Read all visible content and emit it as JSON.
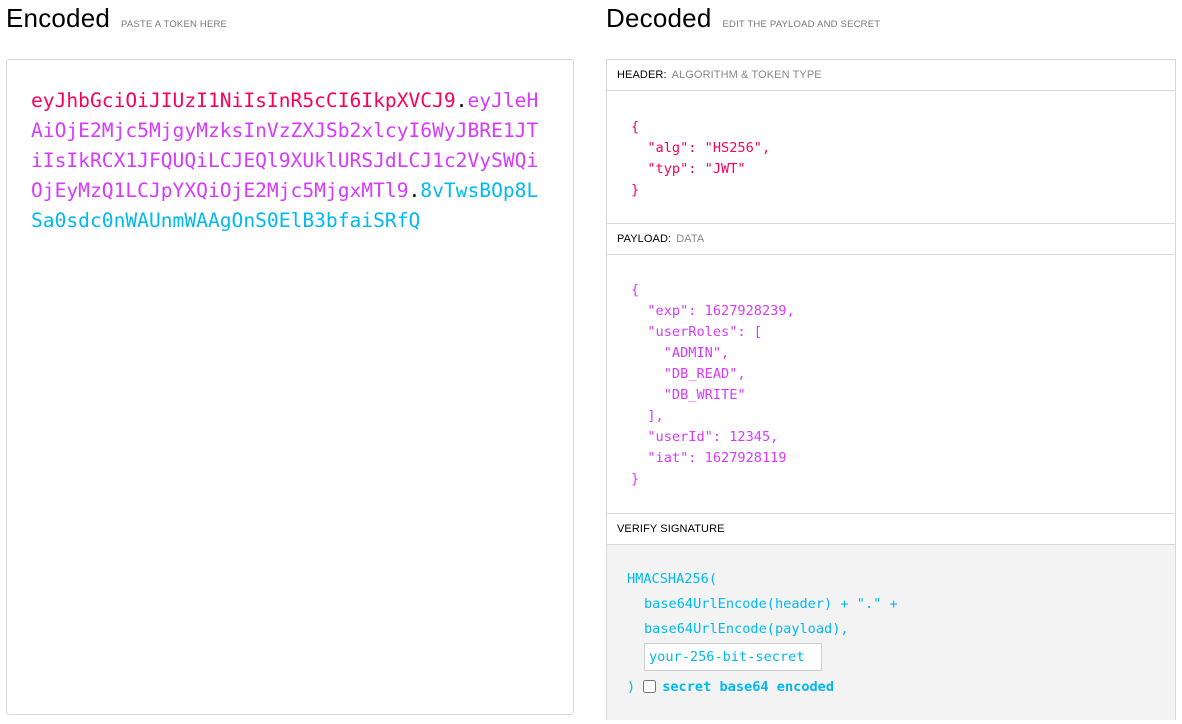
{
  "encoded": {
    "title": "Encoded",
    "hint": "PASTE A TOKEN HERE",
    "token_header": "eyJhbGciOiJIUzI1NiIsInR5cCI6IkpXVCJ9",
    "dot1": ".",
    "token_payload": "eyJleHAiOjE2Mjc5MjgyMzksInVzZXJSb2xlcyI6WyJBRE1JTiIsIkRCX1JFQUQiLCJEQl9XUklURSJdLCJ1c2VySWQiOjEyMzQ1LCJpYXQiOjE2Mjc5MjgxMTl9",
    "dot2": ".",
    "token_signature": "8vTwsBOp8LSa0sdc0nWAUnmWAAgOnS0ElB3bfaiSRfQ"
  },
  "decoded": {
    "title": "Decoded",
    "hint": "EDIT THE PAYLOAD AND SECRET",
    "header": {
      "label": "HEADER:",
      "hint": "ALGORITHM & TOKEN TYPE",
      "json": "{\n  \"alg\": \"HS256\",\n  \"typ\": \"JWT\"\n}"
    },
    "payload": {
      "label": "PAYLOAD:",
      "hint": "DATA",
      "json": "{\n  \"exp\": 1627928239,\n  \"userRoles\": [\n    \"ADMIN\",\n    \"DB_READ\",\n    \"DB_WRITE\"\n  ],\n  \"userId\": 12345,\n  \"iat\": 1627928119\n}"
    },
    "verify": {
      "label": "VERIFY SIGNATURE",
      "fn_open": "HMACSHA256(",
      "line_header": "base64UrlEncode(header) + \".\" +",
      "line_payload": "base64UrlEncode(payload),",
      "secret_placeholder": "your-256-bit-secret",
      "close_paren": ")",
      "checkbox_label": "secret base64 encoded",
      "checkbox_checked": false
    }
  },
  "colors": {
    "header": "#fb015b",
    "payload": "#d63aff",
    "signature": "#00b9f1"
  }
}
